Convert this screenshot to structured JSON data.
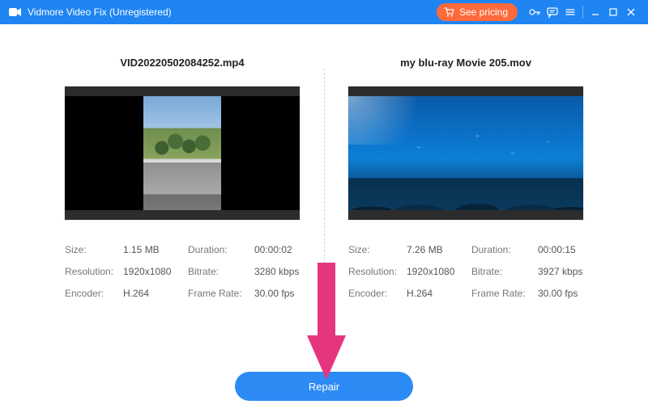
{
  "titlebar": {
    "app_title": "Vidmore Video Fix (Unregistered)",
    "see_pricing_label": "See pricing"
  },
  "left_video": {
    "filename": "VID20220502084252.mp4",
    "size_label": "Size:",
    "size_value": "1.15 MB",
    "duration_label": "Duration:",
    "duration_value": "00:00:02",
    "resolution_label": "Resolution:",
    "resolution_value": "1920x1080",
    "bitrate_label": "Bitrate:",
    "bitrate_value": "3280 kbps",
    "encoder_label": "Encoder:",
    "encoder_value": "H.264",
    "framerate_label": "Frame Rate:",
    "framerate_value": "30.00 fps"
  },
  "right_video": {
    "filename": "my blu-ray Movie 205.mov",
    "size_label": "Size:",
    "size_value": "7.26 MB",
    "duration_label": "Duration:",
    "duration_value": "00:00:15",
    "resolution_label": "Resolution:",
    "resolution_value": "1920x1080",
    "bitrate_label": "Bitrate:",
    "bitrate_value": "3927 kbps",
    "encoder_label": "Encoder:",
    "encoder_value": "H.264",
    "framerate_label": "Frame Rate:",
    "framerate_value": "30.00 fps"
  },
  "repair_button_label": "Repair",
  "annotation": {
    "arrow_color": "#e6357f"
  }
}
